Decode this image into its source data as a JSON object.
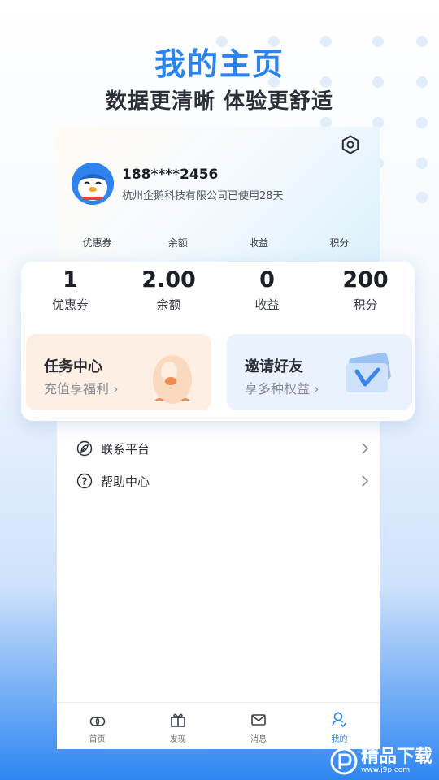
{
  "promo_header": {
    "title": "我的主页",
    "subtitle": "数据更清晰 体验更舒适"
  },
  "profile": {
    "phone": "188****2456",
    "company_line": "杭州企鹅科技有限公司已使用28天"
  },
  "mini_stats_labels": [
    "优惠券",
    "余额",
    "收益",
    "积分"
  ],
  "stats": [
    {
      "value": "1",
      "label": "优惠券"
    },
    {
      "value": "2.00",
      "label": "余额"
    },
    {
      "value": "0",
      "label": "收益"
    },
    {
      "value": "200",
      "label": "积分"
    }
  ],
  "promos": {
    "task": {
      "title": "任务中心",
      "subtitle": "充值享福利 ›"
    },
    "invite": {
      "title": "邀请好友",
      "subtitle": "享多种权益 ›"
    }
  },
  "menu": [
    {
      "label": "联系平台",
      "icon": "leaf-icon"
    },
    {
      "label": "帮助中心",
      "icon": "help-icon"
    }
  ],
  "tabbar": [
    {
      "label": "首页",
      "icon": "home-icon"
    },
    {
      "label": "发现",
      "icon": "gift-icon"
    },
    {
      "label": "消息",
      "icon": "mail-icon"
    },
    {
      "label": "我的",
      "icon": "user-icon"
    }
  ],
  "watermark": {
    "text": "精品下载",
    "url": "www.j9p.com"
  },
  "colors": {
    "accent": "#2a83f0",
    "task_bg": "#fdefe3",
    "invite_bg": "#eaf2fd"
  }
}
